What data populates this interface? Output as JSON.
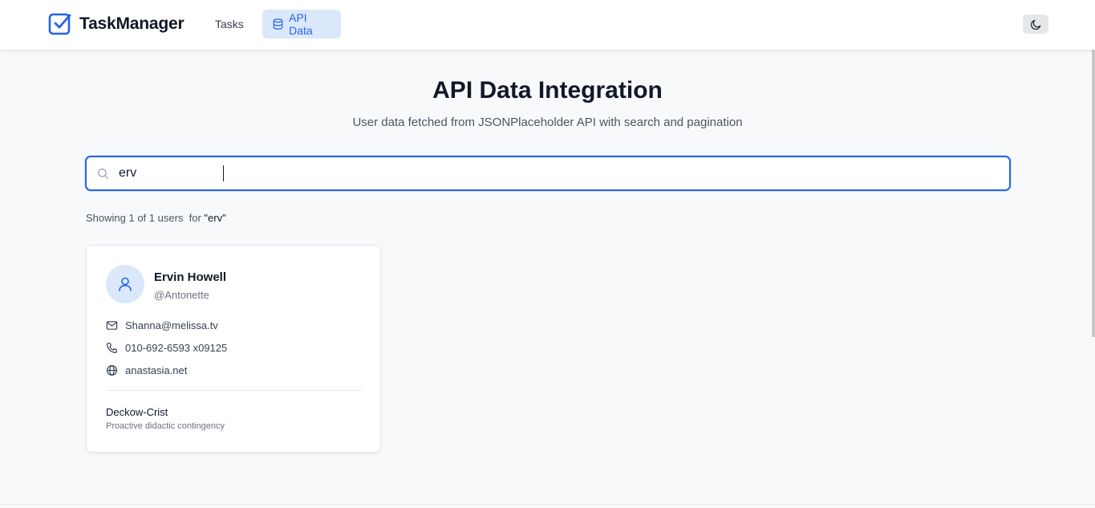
{
  "nav": {
    "brand": "TaskManager",
    "links": [
      {
        "label": "Tasks",
        "active": false
      },
      {
        "label": "API Data",
        "active": true
      }
    ],
    "theme_toggle_icon": "moon-icon"
  },
  "header": {
    "title": "API Data Integration",
    "subtitle": "User data fetched from JSONPlaceholder API with search and pagination"
  },
  "search": {
    "value": "erv",
    "icon": "search-icon"
  },
  "results": {
    "summary": "Showing 1 of 1 users  for ",
    "query": "\"erv\""
  },
  "users": [
    {
      "name": "Ervin Howell",
      "username": "@Antonette",
      "email": "Shanna@melissa.tv",
      "phone": "010-692-6593 x09125",
      "website": "anastasia.net",
      "company": "Deckow-Crist",
      "catch_phrase": "Proactive didactic contingency"
    }
  ],
  "colors": {
    "accent": "#2563eb",
    "accent_light": "#dbe8fb",
    "background": "#f8f9fb",
    "text": "#111827",
    "muted": "#6b7280"
  }
}
